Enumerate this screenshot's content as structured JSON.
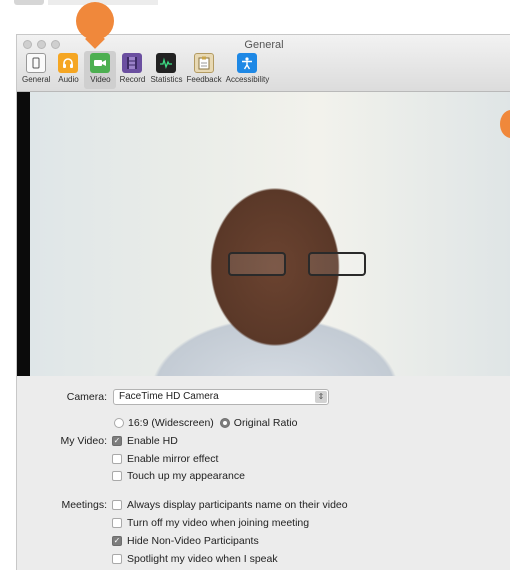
{
  "window": {
    "title": "General"
  },
  "toolbar": {
    "items": [
      {
        "label": "General",
        "icon": "general-icon"
      },
      {
        "label": "Audio",
        "icon": "audio-icon"
      },
      {
        "label": "Video",
        "icon": "video-camera-icon"
      },
      {
        "label": "Record",
        "icon": "record-icon"
      },
      {
        "label": "Statistics",
        "icon": "statistics-icon"
      },
      {
        "label": "Feedback",
        "icon": "feedback-icon"
      },
      {
        "label": "Accessibility",
        "icon": "accessibility-icon"
      }
    ],
    "active": "Video"
  },
  "settings": {
    "camera": {
      "label": "Camera:",
      "value": "FaceTime HD Camera"
    },
    "my_video": {
      "label": "My Video:",
      "ratio_widescreen": "16:9 (Widescreen)",
      "ratio_original": "Original Ratio",
      "enable_hd": "Enable HD",
      "mirror": "Enable mirror effect",
      "touch_up": "Touch up my appearance"
    },
    "meetings": {
      "label": "Meetings:",
      "display_names": "Always display participants name on their video",
      "turn_off_video": "Turn off my video when joining meeting",
      "hide_non_video": "Hide Non-Video Participants",
      "spotlight": "Spotlight my video when I speak"
    }
  },
  "colors": {
    "accent_marker": "#f0883b",
    "video_tab": "#4caf50"
  }
}
